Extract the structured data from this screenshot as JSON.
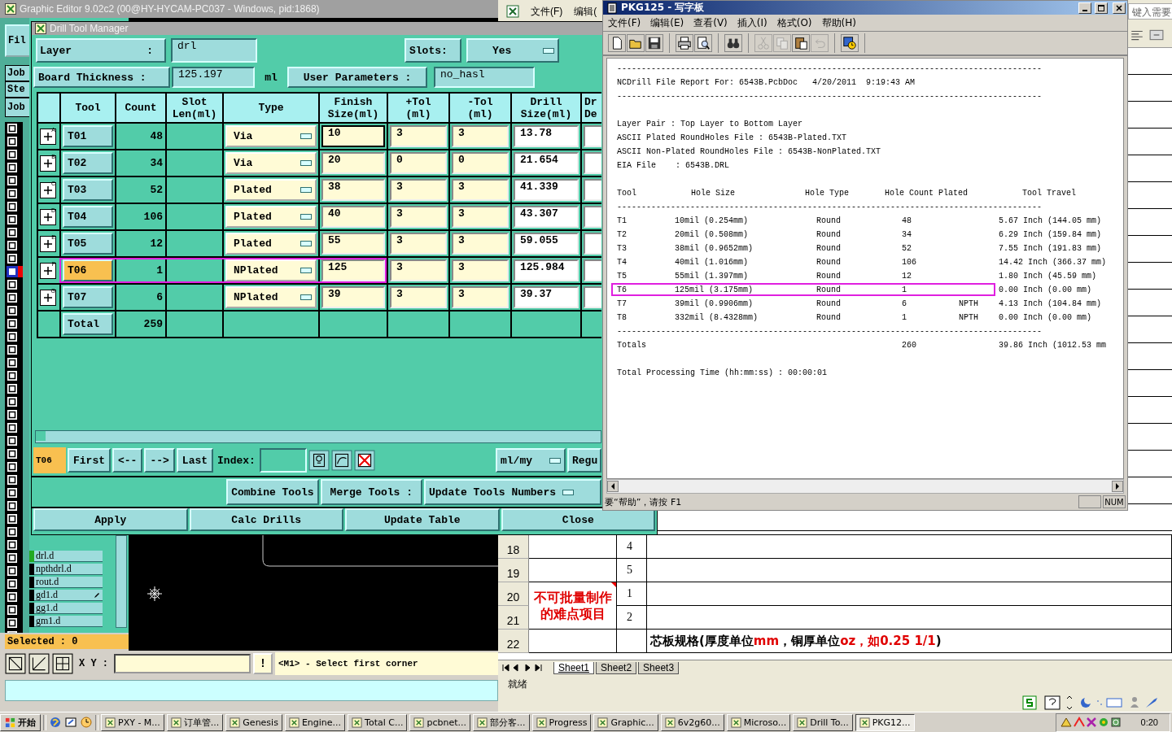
{
  "graphic_editor": {
    "title": "Graphic Editor 9.02c2 (00@HY-HYCAM-PC037 - Windows, pid:1868)",
    "side_buttons": [
      "Fil",
      "Job",
      "Ste",
      "Job"
    ],
    "layers": [
      {
        "name": "drl.d",
        "active": true,
        "editing": false
      },
      {
        "name": "npthdrl.d",
        "active": false,
        "editing": false
      },
      {
        "name": "rout.d",
        "active": false,
        "editing": false
      },
      {
        "name": "gd1.d",
        "active": false,
        "editing": true
      },
      {
        "name": "gg1.d",
        "active": false,
        "editing": false
      },
      {
        "name": "gm1.d",
        "active": false,
        "editing": false
      }
    ],
    "selected_label": "Selected : 0",
    "xy_label": "X Y :",
    "command_button": "!",
    "prompt": "<M1> - Select first corner"
  },
  "excel": {
    "menus": [
      "文件(F)",
      "编辑("
    ],
    "help_box": "键入需要",
    "rows": [
      {
        "header": "18",
        "column_c": "4"
      },
      {
        "header": "19",
        "column_c": "5"
      },
      {
        "header": "20",
        "column_c": "1"
      },
      {
        "header": "21",
        "column_c": "2"
      },
      {
        "header": "22"
      }
    ],
    "merged_cell": "不可批量制作的难点项目",
    "row_22_text": [
      {
        "text": "芯板规格(厚度单位",
        "highlight": false
      },
      {
        "text": "mm",
        "highlight": true
      },
      {
        "text": "，铜厚单位",
        "highlight": false
      },
      {
        "text": "oz，如0.25 1/1",
        "highlight": true
      },
      {
        "text": ")",
        "highlight": false
      }
    ],
    "sheets": [
      {
        "label": "Sheet1",
        "selected": true
      },
      {
        "label": "Sheet2",
        "selected": false
      },
      {
        "label": "Sheet3",
        "selected": false
      }
    ],
    "status": "就绪"
  },
  "drill_tool_manager": {
    "title": "Drill Tool Manager",
    "layer_label": "Layer",
    "layer_colon": ":",
    "layer_value": "drl",
    "slots_label": "Slots:",
    "slots_value": "Yes",
    "thickness_label": "Board Thickness :",
    "thickness_value": "125.197",
    "thickness_unit": "ml",
    "user_params_label": "User Parameters :",
    "user_params_value": "no_hasl",
    "columns": [
      [
        "Tool"
      ],
      [
        "Count"
      ],
      [
        "Slot",
        "Len(ml)"
      ],
      [
        "Type"
      ],
      [
        "Finish",
        "Size(ml)"
      ],
      [
        "+Tol",
        "(ml)"
      ],
      [
        "-Tol",
        "(ml)"
      ],
      [
        "Drill",
        "Size(ml)"
      ],
      [
        "Dr",
        "De"
      ]
    ],
    "rows": [
      {
        "marker": "A",
        "tool": "T01",
        "count": "48",
        "type": "Via",
        "finish": "10",
        "plus_tol": "3",
        "minus_tol": "3",
        "drill": "13.78",
        "selected": false,
        "focused": true
      },
      {
        "marker": "B",
        "tool": "T02",
        "count": "34",
        "type": "Via",
        "finish": "20",
        "plus_tol": "0",
        "minus_tol": "0",
        "drill": "21.654",
        "selected": false,
        "focused": false
      },
      {
        "marker": "C",
        "tool": "T03",
        "count": "52",
        "type": "Plated",
        "finish": "38",
        "plus_tol": "3",
        "minus_tol": "3",
        "drill": "41.339",
        "selected": false,
        "focused": false
      },
      {
        "marker": "D",
        "tool": "T04",
        "count": "106",
        "type": "Plated",
        "finish": "40",
        "plus_tol": "3",
        "minus_tol": "3",
        "drill": "43.307",
        "selected": false,
        "focused": false
      },
      {
        "marker": "E",
        "tool": "T05",
        "count": "12",
        "type": "Plated",
        "finish": "55",
        "plus_tol": "3",
        "minus_tol": "3",
        "drill": "59.055",
        "selected": false,
        "focused": false
      },
      {
        "marker": "F",
        "tool": "T06",
        "count": "1",
        "type": "NPlated",
        "finish": "125",
        "plus_tol": "3",
        "minus_tol": "3",
        "drill": "125.984",
        "selected": true,
        "focused": false
      },
      {
        "marker": "G",
        "tool": "T07",
        "count": "6",
        "type": "NPlated",
        "finish": "39",
        "plus_tol": "3",
        "minus_tol": "3",
        "drill": "39.37",
        "selected": false,
        "focused": false
      }
    ],
    "total": {
      "label": "Total",
      "count": "259"
    },
    "nav": {
      "current": "T06",
      "buttons": [
        "First",
        "<--",
        "-->",
        "Last"
      ],
      "index_label": "Index:",
      "units": "ml/my",
      "cut_button": "Regu"
    },
    "merge_row": {
      "combine": "Combine Tools",
      "merge_label": "Merge Tools :",
      "merge_value": "Update Tools Numbers"
    },
    "actions": [
      "Apply",
      "Calc Drills",
      "Update Table",
      "Close"
    ]
  },
  "wordpad": {
    "title": "PKG125 - 写字板",
    "menus": [
      "文件(F)",
      "编辑(E)",
      "查看(V)",
      "插入(I)",
      "格式(O)",
      "帮助(H)"
    ],
    "report": {
      "header": [
        "---------------------------------------------------------------------------------------",
        "NCDrill File Report For: 6543B.PcbDoc   4/20/2011  9:19:43 AM",
        "---------------------------------------------------------------------------------------"
      ],
      "info": [
        "Layer Pair : Top Layer to Bottom Layer",
        "ASCII Plated RoundHoles File : 6543B-Plated.TXT",
        "ASCII Non-Plated RoundHoles File : 6543B-NonPlated.TXT",
        "EIA File    : 6543B.DRL"
      ],
      "columns": [
        "Tool",
        "Hole Size",
        "Hole Type",
        "Hole Count Plated",
        "Tool Travel"
      ],
      "rule_top": "---------------------------------------------------------------------------------------",
      "rows": [
        {
          "tool": "T1",
          "size": "10mil (0.254mm)",
          "type": "Round",
          "count": "48",
          "travel": "5.67 Inch (144.05 mm)",
          "selected": false
        },
        {
          "tool": "T2",
          "size": "20mil (0.508mm)",
          "type": "Round",
          "count": "34",
          "travel": "6.29 Inch (159.84 mm)",
          "selected": false
        },
        {
          "tool": "T3",
          "size": "38mil (0.9652mm)",
          "type": "Round",
          "count": "52",
          "travel": "7.55 Inch (191.83 mm)",
          "selected": false
        },
        {
          "tool": "T4",
          "size": "40mil (1.016mm)",
          "type": "Round",
          "count": "106",
          "travel": "14.42 Inch (366.37 mm)",
          "selected": false
        },
        {
          "tool": "T5",
          "size": "55mil (1.397mm)",
          "type": "Round",
          "count": "12",
          "travel": "1.80 Inch (45.59 mm)",
          "selected": false
        },
        {
          "tool": "T6",
          "size": "125mil (3.175mm)",
          "type": "Round",
          "count": "1",
          "travel": "0.00 Inch (0.00 mm)",
          "selected": true
        },
        {
          "tool": "T7",
          "size": "39mil (0.9906mm)",
          "type": "Round",
          "count": "6",
          "plated": "NPTH",
          "travel": "4.13 Inch (104.84 mm)",
          "selected": false
        },
        {
          "tool": "T8",
          "size": "332mil (8.4328mm)",
          "type": "Round",
          "count": "1",
          "plated": "NPTH",
          "travel": "0.00 Inch (0.00 mm)",
          "selected": false
        }
      ],
      "rule_bottom": "---------------------------------------------------------------------------------------",
      "totals": {
        "label": "Totals",
        "count": "260",
        "travel": "39.86 Inch (1012.53 mm"
      },
      "processing_time": "Total Processing Time (hh:mm:ss) : 00:00:01"
    },
    "status": "要“帮助”，请按 F1",
    "indicator": "NUM"
  },
  "taskbar": {
    "start": "开始",
    "tasks": [
      {
        "label": "PXY - M...",
        "selected": false
      },
      {
        "label": "订单管...",
        "selected": false
      },
      {
        "label": "Genesis",
        "selected": false
      },
      {
        "label": "Engine...",
        "selected": false
      },
      {
        "label": "Total C...",
        "selected": false
      },
      {
        "label": "pcbnet...",
        "selected": false
      },
      {
        "label": "部分客...",
        "selected": false
      },
      {
        "label": "Progress",
        "selected": false
      },
      {
        "label": "Graphic...",
        "selected": false
      },
      {
        "label": "6v2g60...",
        "selected": false
      },
      {
        "label": "Microso...",
        "selected": false
      },
      {
        "label": "Drill To...",
        "selected": false
      },
      {
        "label": "PKG12...",
        "selected": true
      }
    ],
    "clock": "0:20"
  }
}
